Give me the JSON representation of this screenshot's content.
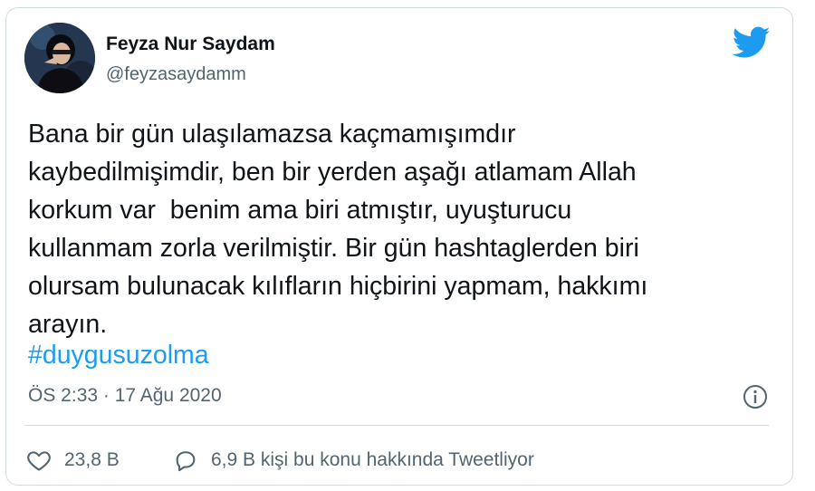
{
  "author": {
    "name": "Feyza Nur Saydam",
    "handle": "@feyzasaydamm"
  },
  "tweet": {
    "text": "Bana bir gün ulaşılamazsa kaçmamışımdır\nkaybedilmişimdir, ben bir yerden aşağı atlamam Allah\nkorkum var  benim ama biri atmıştır, uyuşturucu\nkullanmam zorla verilmiştir. Bir gün hashtaglerden biri\nolursam bulunacak kılıfların hiçbirini yapmam, hakkımı\narayın.",
    "hashtag": "#duygusuzolma",
    "timestamp": "ÖS 2:33 · 17 Ağu 2020"
  },
  "actions": {
    "likes": "23,8 B",
    "replies": "6,9 B kişi bu konu hakkında Tweetliyor"
  },
  "colors": {
    "twitter_blue": "#1d9bf0",
    "text_primary": "#0f1419",
    "text_secondary": "#536471",
    "border": "#cfd9de"
  },
  "icons": {
    "brand": "twitter-bird-icon",
    "info": "info-icon",
    "like": "heart-icon",
    "reply": "speech-bubble-icon"
  }
}
